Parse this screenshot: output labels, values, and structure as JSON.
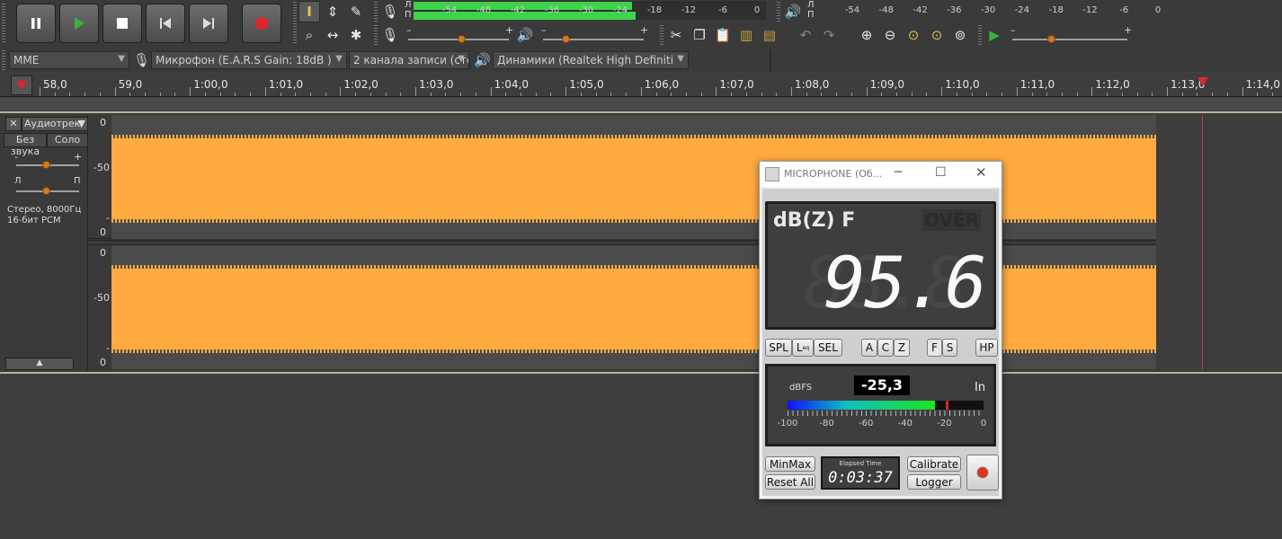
{
  "transport": {
    "pause": "pause-icon",
    "play": "play-icon",
    "stop": "stop-icon",
    "skip_start": "skip-start-icon",
    "skip_end": "skip-end-icon",
    "record": "record-icon"
  },
  "meters": {
    "rec_channels": [
      "Л",
      "П"
    ],
    "play_channels": [
      "Л",
      "П"
    ],
    "rec_scale": [
      "-54",
      "-48",
      "-42",
      "-36",
      "-30",
      "-24",
      "-18",
      "-12",
      "-6",
      "0"
    ],
    "play_scale": [
      "-54",
      "-48",
      "-42",
      "-36",
      "-30",
      "-24",
      "-18",
      "-12",
      "-6",
      "0"
    ],
    "rec_level": 0.62
  },
  "sliders": {
    "minus": "–",
    "plus": "+"
  },
  "device": {
    "host": "MME",
    "mic": "Микрофон (E.A.R.S Gain: 18dB  )",
    "channels": "2  канала записи (сте",
    "speakers": "Динамики (Realtek High Definiti"
  },
  "ruler": {
    "labels": [
      "58,0",
      "59,0",
      "1:00,0",
      "1:01,0",
      "1:02,0",
      "1:03,0",
      "1:04,0",
      "1:05,0",
      "1:06,0",
      "1:07,0",
      "1:08,0",
      "1:09,0",
      "1:10,0",
      "1:11,0",
      "1:12,0",
      "1:13,0",
      "1:14,0"
    ]
  },
  "track": {
    "name": "Аудиотрек",
    "mute": "Без звука",
    "solo": "Соло",
    "gain_minus": "-",
    "gain_plus": "+",
    "pan_left": "Л",
    "pan_right": "П",
    "info_line1": "Стерео, 8000Гц",
    "info_line2": "16-бит PCM",
    "scale_top": "0",
    "scale_mid": "-50",
    "scale_low": "-",
    "scale_bottom": "0"
  },
  "dialog": {
    "title": "MICROPHONE (Об...",
    "mode": "dB(Z) F",
    "over": "OVER",
    "value": "95.6",
    "ghost": "88.8",
    "buttons_weight": [
      "SPL",
      "L",
      "SEL"
    ],
    "leq_sub": "eq",
    "freq": [
      "A",
      "C",
      "Z"
    ],
    "time": [
      "F",
      "S"
    ],
    "hp": "HP",
    "dbfs_label": "dBFS",
    "dbfs_value": "-25,3",
    "in_label": "In",
    "bar_level": 0.75,
    "bar_scale": [
      "-100",
      "-80",
      "-60",
      "-40",
      "-20",
      "0"
    ],
    "minmax": "MinMax",
    "reset": "Reset All",
    "elapsed_label": "Elapsed Time",
    "elapsed": "0:03:37",
    "calibrate": "Calibrate",
    "logger": "Logger"
  }
}
